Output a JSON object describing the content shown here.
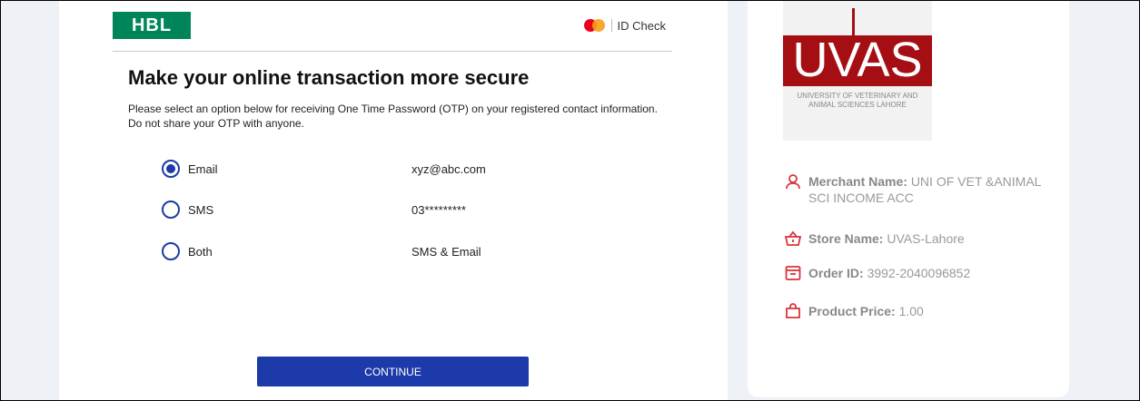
{
  "header": {
    "bank_logo_text": "HBL",
    "id_check_label": "ID Check"
  },
  "main": {
    "title": "Make your online transaction more secure",
    "description": "Please select an option below for receiving One Time Password (OTP) on your registered contact information. Do not share your OTP with anyone.",
    "options": [
      {
        "label": "Email",
        "value": "xyz@abc.com",
        "selected": true
      },
      {
        "label": "SMS",
        "value": "03*********",
        "selected": false
      },
      {
        "label": "Both",
        "value": "SMS & Email",
        "selected": false
      }
    ],
    "continue_label": "CONTINUE"
  },
  "merchant": {
    "logo_text": "UVAS",
    "logo_subtitle": "UNIVERSITY OF VETERINARY AND ANIMAL SCIENCES LAHORE",
    "merchant_name_label": "Merchant Name:",
    "merchant_name_value": "UNI OF VET &ANIMAL SCI INCOME ACC",
    "store_name_label": "Store Name:",
    "store_name_value": "UVAS-Lahore",
    "order_id_label": "Order ID:",
    "order_id_value": "3992-2040096852",
    "product_price_label": "Product Price:",
    "product_price_value": "1.00"
  },
  "colors": {
    "brand_green": "#00855a",
    "primary_blue": "#1c3aa9",
    "icon_red": "#d9343a",
    "uvas_red": "#a50f14"
  },
  "icons": [
    "mastercard-logo",
    "user-icon",
    "basket-icon",
    "archive-icon",
    "shopping-bag-icon"
  ]
}
